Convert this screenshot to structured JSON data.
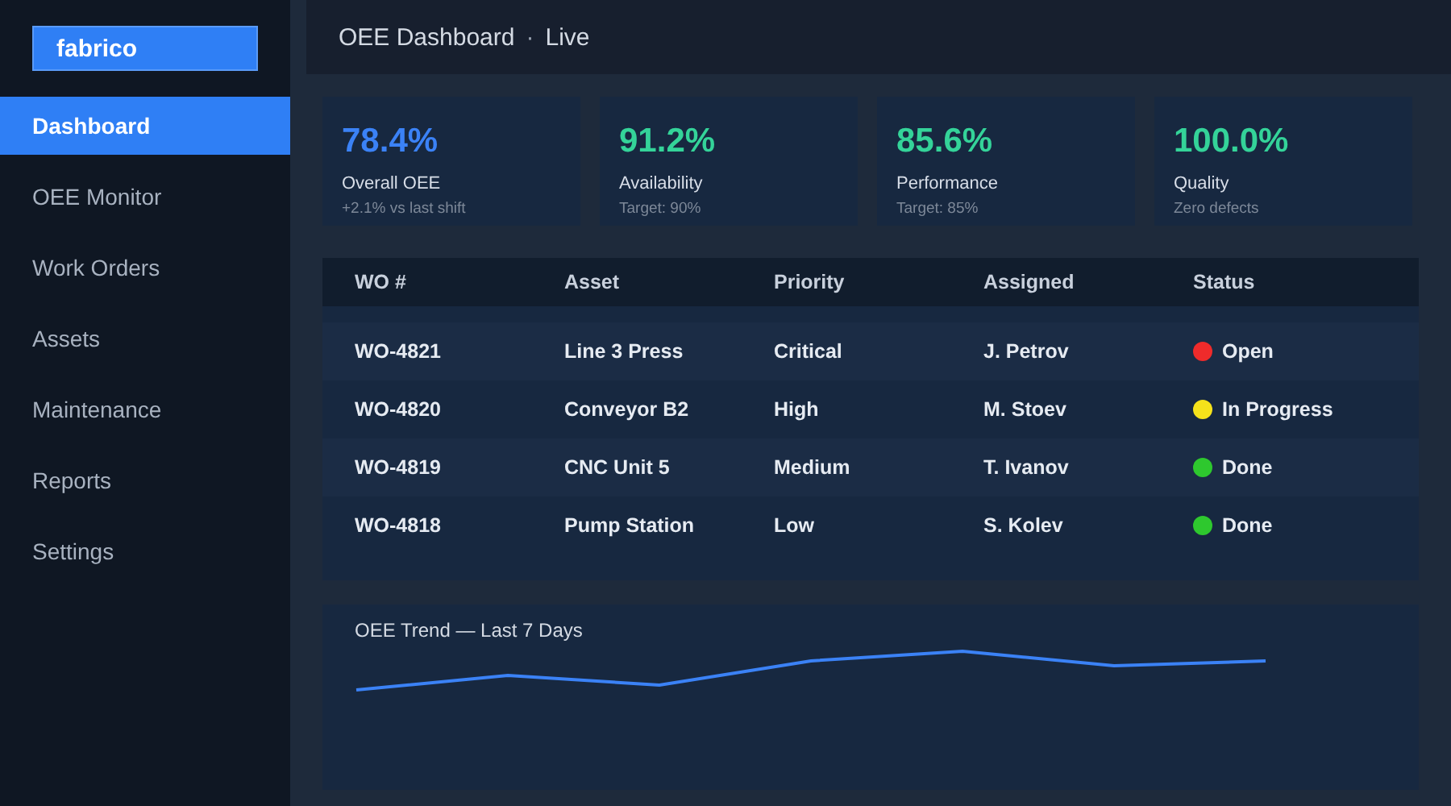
{
  "logo": "fabrico",
  "nav": [
    {
      "label": "Dashboard",
      "selected": true
    },
    {
      "label": "OEE Monitor",
      "selected": false
    },
    {
      "label": "Work Orders",
      "selected": false
    },
    {
      "label": "Assets",
      "selected": false
    },
    {
      "label": "Maintenance",
      "selected": false
    },
    {
      "label": "Reports",
      "selected": false
    },
    {
      "label": "Settings",
      "selected": false
    }
  ],
  "header": {
    "title": "OEE Dashboard",
    "separator": "·",
    "mode": "Live"
  },
  "kpis": [
    {
      "value": "78.4%",
      "label": "Overall OEE",
      "note": "+2.1% vs last shift",
      "color": "#3b82f6"
    },
    {
      "value": "91.2%",
      "label": "Availability",
      "note": "Target: 90%",
      "color": "#34d399"
    },
    {
      "value": "85.6%",
      "label": "Performance",
      "note": "Target: 85%",
      "color": "#34d399"
    },
    {
      "value": "100.0%",
      "label": "Quality",
      "note": "Zero defects",
      "color": "#34d399"
    }
  ],
  "table": {
    "columns": [
      "WO #",
      "Asset",
      "Priority",
      "Assigned",
      "Status"
    ],
    "rows": [
      {
        "wo": "WO-4821",
        "asset": "Line 3 Press",
        "priority": "Critical",
        "assigned": "J. Petrov",
        "status": "Open",
        "color": "#ef2b2b"
      },
      {
        "wo": "WO-4820",
        "asset": "Conveyor B2",
        "priority": "High",
        "assigned": "M. Stoev",
        "status": "In Progress",
        "color": "#f5e21b"
      },
      {
        "wo": "WO-4819",
        "asset": "CNC Unit 5",
        "priority": "Medium",
        "assigned": "T. Ivanov",
        "status": "Done",
        "color": "#2ec82e"
      },
      {
        "wo": "WO-4818",
        "asset": "Pump Station",
        "priority": "Low",
        "assigned": "S. Kolev",
        "status": "Done",
        "color": "#2ec82e"
      }
    ]
  },
  "trend": {
    "title": "OEE Trend — Last 7 Days"
  }
}
